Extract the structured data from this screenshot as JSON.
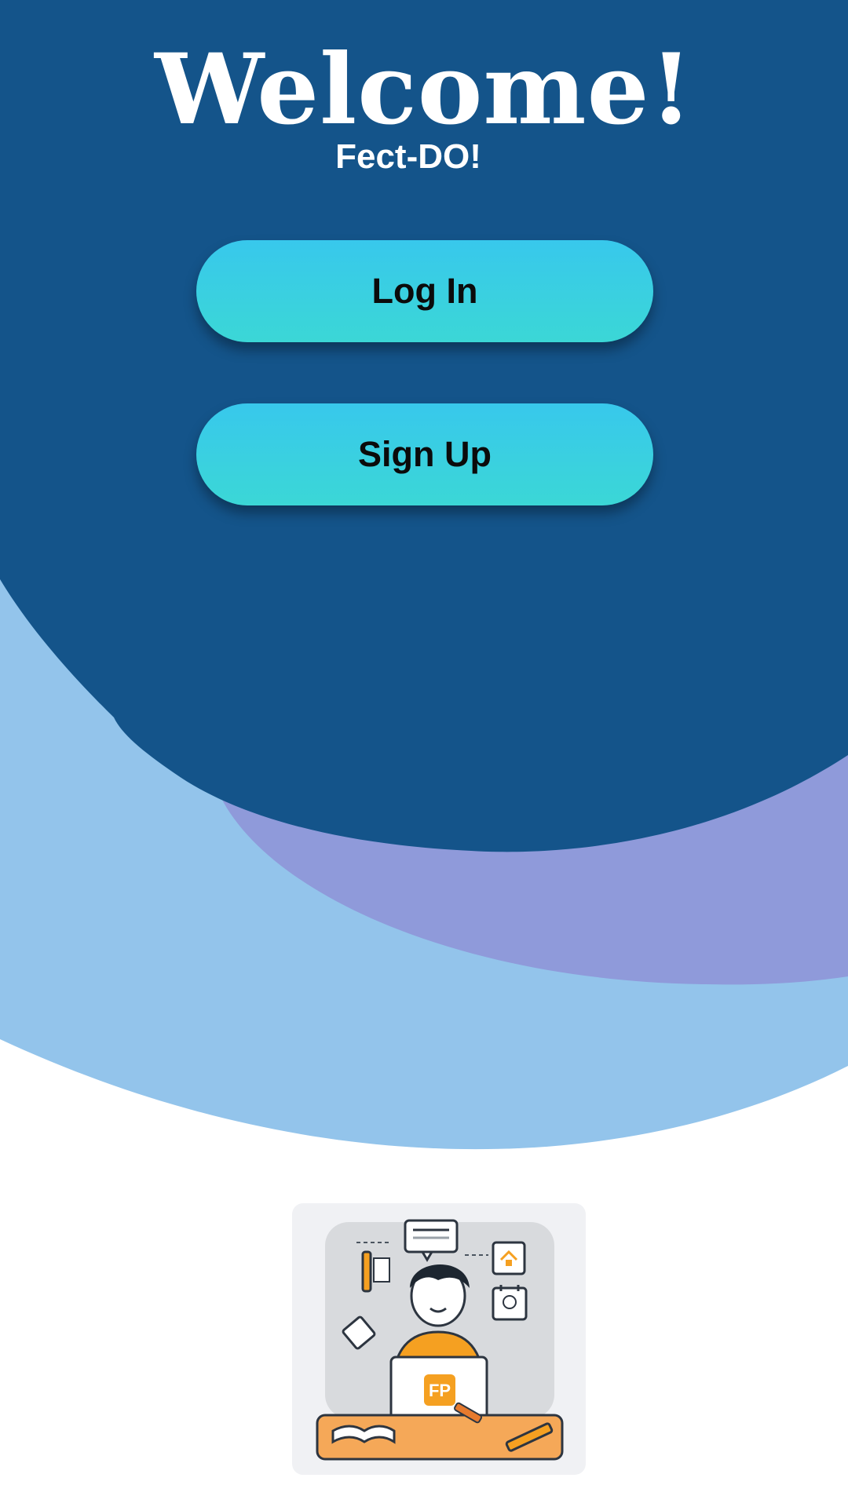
{
  "header": {
    "title": "Welcome!",
    "subtitle": "Fect-DO!"
  },
  "actions": {
    "login_label": "Log In",
    "signup_label": "Sign Up"
  },
  "colors": {
    "primary_background": "#14548a",
    "light_wave": "#93c4eb",
    "purple_wave": "#8f9ada",
    "button_gradient_top": "#38c8ec",
    "button_gradient_bottom": "#3bd7d6",
    "illustration_accent": "#f5a021"
  },
  "illustration": {
    "icon": "person-working-on-laptop-illustration",
    "laptop_logo": "FP"
  }
}
